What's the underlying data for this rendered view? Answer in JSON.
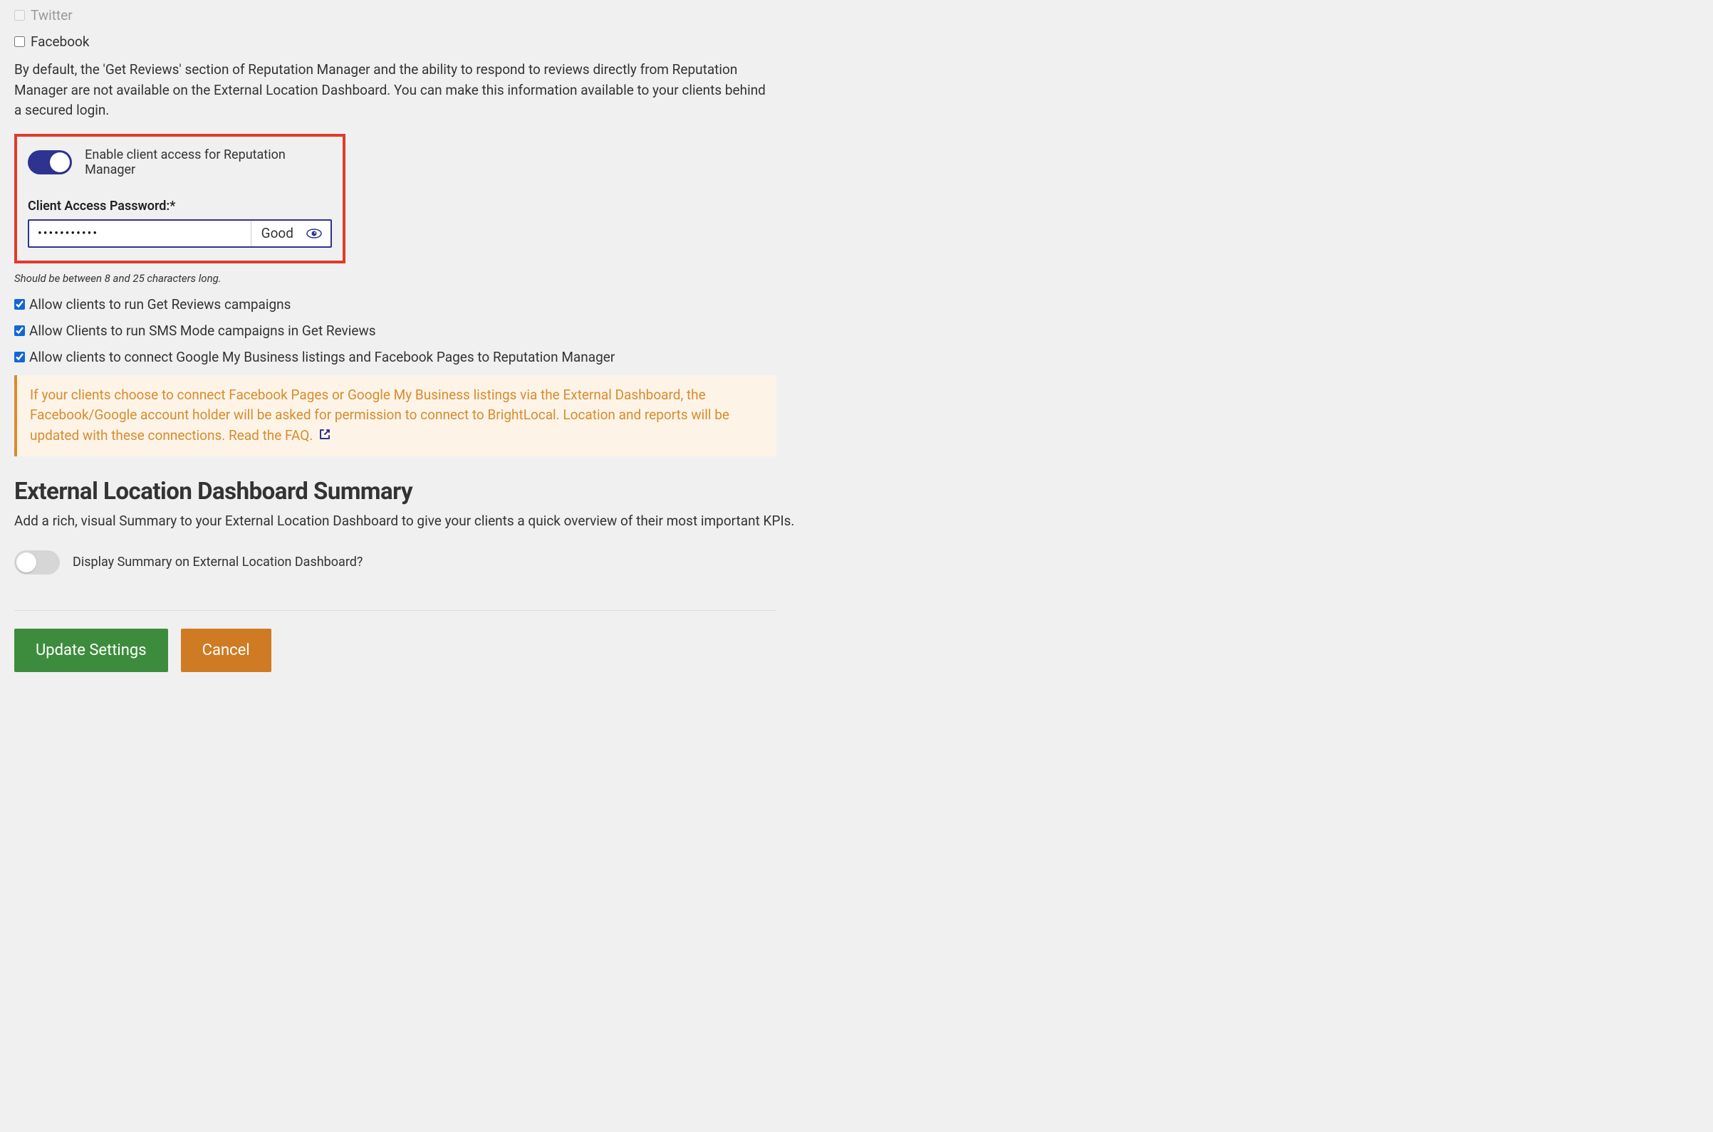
{
  "social": {
    "twitter_label": "Twitter",
    "facebook_label": "Facebook"
  },
  "rep_manager": {
    "description": "By default, the 'Get Reviews' section of Reputation Manager and the ability to respond to reviews directly from Reputation Manager are not available on the External Location Dashboard. You can make this information available to your clients behind a secured login.",
    "enable_toggle_label": "Enable client access for Reputation Manager",
    "password_label": "Client Access Password:*",
    "password_value": "•••••••••••",
    "password_strength": "Good",
    "password_hint": "Should be between 8 and 25 characters long.",
    "allow_get_reviews": "Allow clients to run Get Reviews campaigns",
    "allow_sms": "Allow Clients to run SMS Mode campaigns in Get Reviews",
    "allow_connect": "Allow clients to connect Google My Business listings and Facebook Pages to Reputation Manager"
  },
  "callout": {
    "text": "If your clients choose to connect Facebook Pages or Google My Business listings via the External Dashboard, the Facebook/Google account holder will be asked for permission to connect to BrightLocal. Location and reports will be updated with these connections. ",
    "link_text": "Read the FAQ."
  },
  "summary": {
    "heading": "External Location Dashboard Summary",
    "description": "Add a rich, visual Summary to your External Location Dashboard to give your clients a quick overview of their most important KPIs.",
    "toggle_label": "Display Summary on External Location Dashboard?"
  },
  "buttons": {
    "update": "Update Settings",
    "cancel": "Cancel"
  }
}
